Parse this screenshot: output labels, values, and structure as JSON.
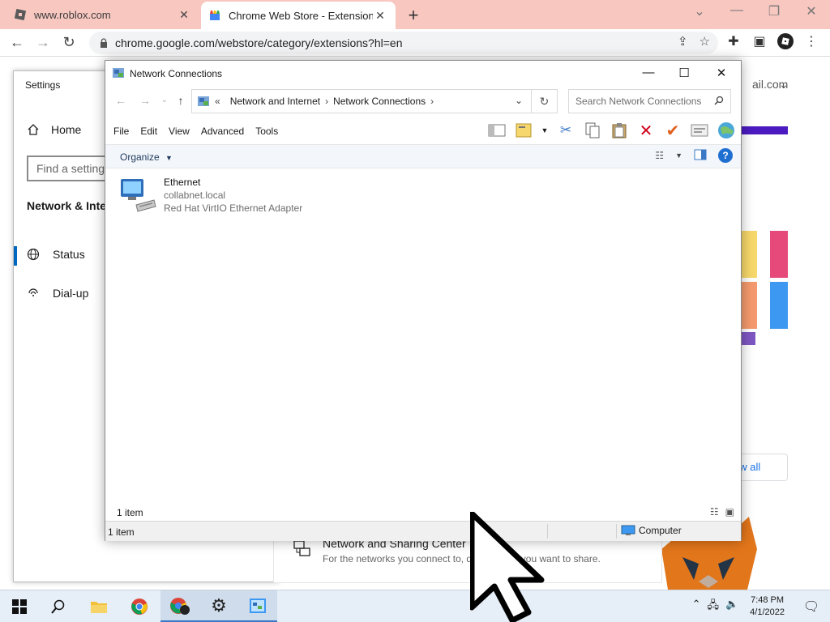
{
  "browser": {
    "tabs": [
      {
        "title": "www.roblox.com",
        "active": false
      },
      {
        "title": "Chrome Web Store - Extensions",
        "active": true
      }
    ],
    "url": "chrome.google.com/webstore/category/extensions?hl=en",
    "page_fragments": {
      "email_link": "ail.com",
      "view_all": "ew all"
    }
  },
  "settings": {
    "title": "Settings",
    "home": "Home",
    "search_placeholder": "Find a setting",
    "section": "Network & Inte",
    "items": [
      {
        "label": "Status",
        "icon": "globe-icon",
        "selected": true
      },
      {
        "label": "Dial-up",
        "icon": "dialup-icon",
        "selected": false
      }
    ],
    "card": {
      "title": "Network and Sharing Center",
      "subtitle": "For the networks you connect to, decide what you want to share."
    }
  },
  "network_connections": {
    "title": "Network Connections",
    "breadcrumb": [
      "Network and Internet",
      "Network Connections"
    ],
    "search_placeholder": "Search Network Connections",
    "menu": [
      "File",
      "Edit",
      "View",
      "Advanced",
      "Tools"
    ],
    "organize_label": "Organize",
    "connection": {
      "name": "Ethernet",
      "network": "collabnet.local",
      "adapter": "Red Hat VirtIO Ethernet Adapter"
    },
    "item_count": "1 item",
    "status_count": "1 item",
    "status_zone": "Computer"
  },
  "taskbar": {
    "time": "7:48 PM",
    "date": "4/1/2022"
  },
  "colors": {
    "tab_bar": "#f7c7c0",
    "accent": "#0067c0",
    "taskbar": "#e6eef7"
  }
}
